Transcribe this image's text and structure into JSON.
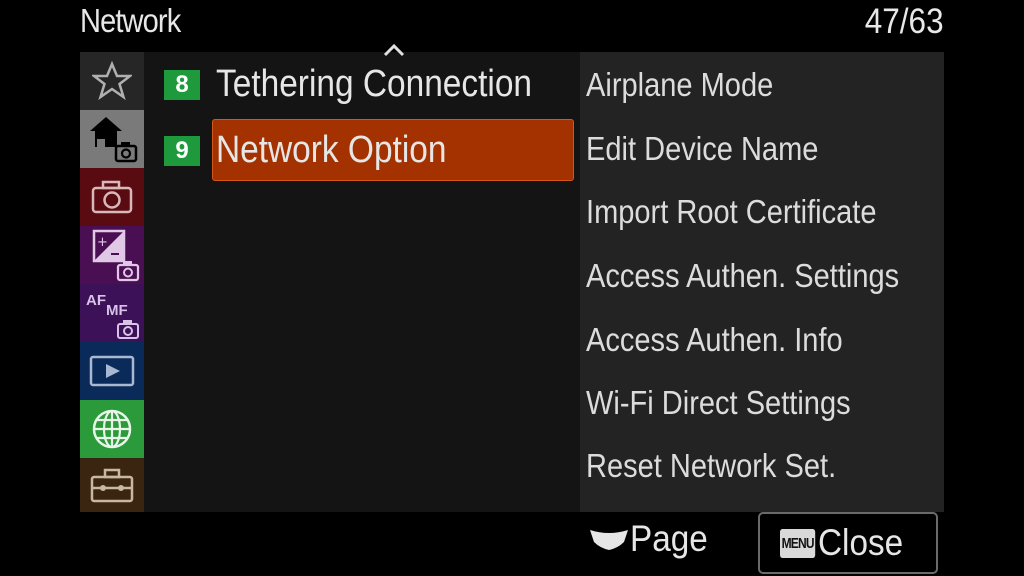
{
  "header": {
    "title": "Network",
    "page_counter": "47/63"
  },
  "sidebar": {
    "items": [
      {
        "icon": "star-icon",
        "name": "My Menu",
        "color": "#262626"
      },
      {
        "icon": "home-camera-icon",
        "name": "Main",
        "color": "#7a7a7a",
        "active": true
      },
      {
        "icon": "camera-icon",
        "name": "Shooting",
        "color": "#5a0b12"
      },
      {
        "icon": "exposure-camera-icon",
        "name": "Exposure/Color",
        "color": "#4a0f52"
      },
      {
        "icon": "af-mf-camera-icon",
        "name": "Focus",
        "color": "#3d1157"
      },
      {
        "icon": "playback-icon",
        "name": "Playback",
        "color": "#0a2a5a"
      },
      {
        "icon": "globe-icon",
        "name": "Network",
        "color": "#2a9a3a"
      },
      {
        "icon": "toolbox-icon",
        "name": "Setup",
        "color": "#3a2610"
      }
    ]
  },
  "menu": {
    "items": [
      {
        "number": "8",
        "label": "Tethering Connection",
        "selected": false
      },
      {
        "number": "9",
        "label": "Network Option",
        "selected": true
      }
    ],
    "scroll_up_indicator": "^"
  },
  "submenu": {
    "items": [
      "Airplane Mode",
      "Edit Device Name",
      "Import Root Certificate",
      "Access Authen. Settings",
      "Access Authen. Info",
      "Wi-Fi Direct Settings",
      "Reset Network Set."
    ]
  },
  "footer": {
    "page_label": "Page",
    "page_icon": "control-wheel-icon",
    "menu_key": "MENU",
    "close_label": "Close"
  },
  "colors": {
    "accent_selected": "#a33200",
    "badge": "#1e9a3c"
  }
}
